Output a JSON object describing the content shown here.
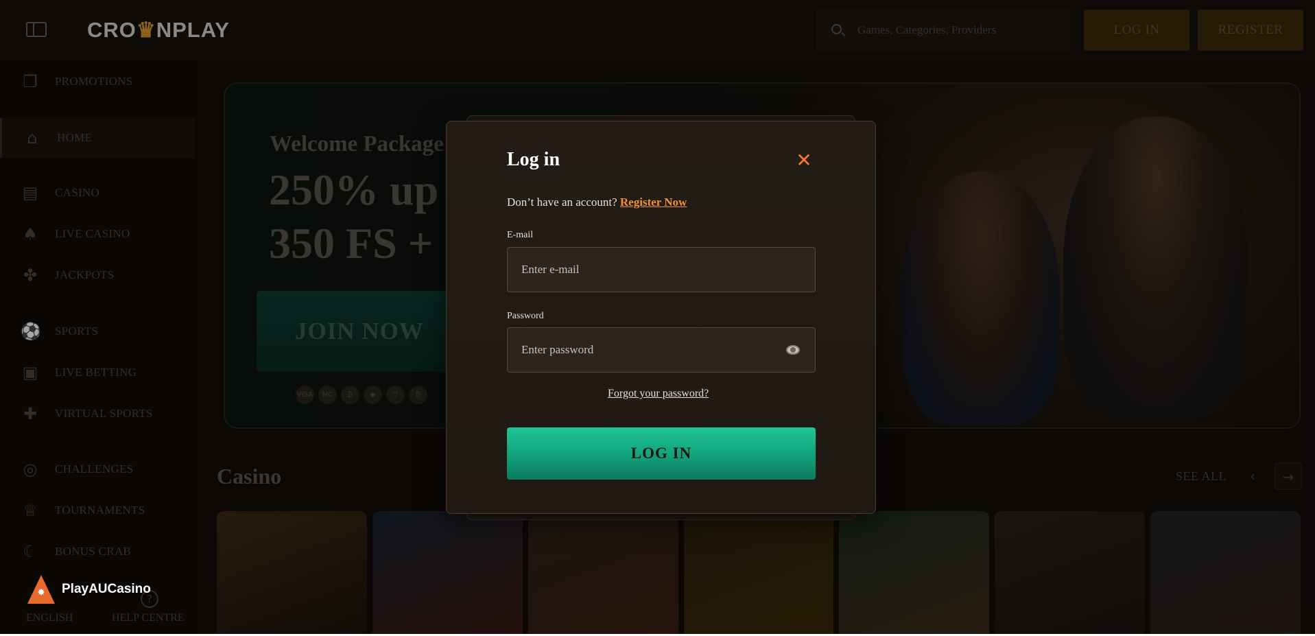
{
  "header": {
    "logo_left": "CRO",
    "logo_crown": "♛",
    "logo_right": "NPLAY",
    "search_placeholder": "Games, Categories, Providers",
    "login_label": "LOG IN",
    "register_label": "REGISTER"
  },
  "sidebar": {
    "items": [
      {
        "label": "PROMOTIONS",
        "icon": "gift-icon"
      },
      {
        "label": "HOME",
        "icon": "home-icon"
      },
      {
        "label": "CASINO",
        "icon": "slot-machine-icon"
      },
      {
        "label": "LIVE CASINO",
        "icon": "spade-icon"
      },
      {
        "label": "JACKPOTS",
        "icon": "clover-icon"
      },
      {
        "label": "SPORTS",
        "icon": "ball-icon"
      },
      {
        "label": "LIVE BETTING",
        "icon": "tv-icon"
      },
      {
        "label": "VIRTUAL SPORTS",
        "icon": "gamepad-icon"
      },
      {
        "label": "CHALLENGES",
        "icon": "medal-icon"
      },
      {
        "label": "TOURNAMENTS",
        "icon": "trophy-icon"
      },
      {
        "label": "BONUS CRAB",
        "icon": "claw-icon"
      }
    ],
    "language": "ENGLISH",
    "help": "HELP CENTRE"
  },
  "hero": {
    "subtitle": "Welcome Package",
    "title_line1": "250% up",
    "title_line2": "350 FS +",
    "cta": "JOIN NOW",
    "payment_icons": [
      "VISA",
      "MC",
      "₿",
      "◆",
      "▽",
      "₿"
    ]
  },
  "casino_section": {
    "title": "Casino",
    "see_all": "SEE ALL"
  },
  "modal": {
    "title": "Log in",
    "close_glyph": "✕",
    "no_account_text": "Don’t have an account?",
    "register_link": "Register Now",
    "email_label": "E-mail",
    "email_placeholder": "Enter e-mail",
    "password_label": "Password",
    "password_placeholder": "Enter password",
    "forgot_link": "Forgot your password?",
    "submit_label": "LOG IN"
  },
  "brand_badge": {
    "name": "PlayAUCasino"
  },
  "colors": {
    "accent_orange": "#f0922f",
    "primary_green": "#1fc796",
    "background": "#120d0a"
  }
}
